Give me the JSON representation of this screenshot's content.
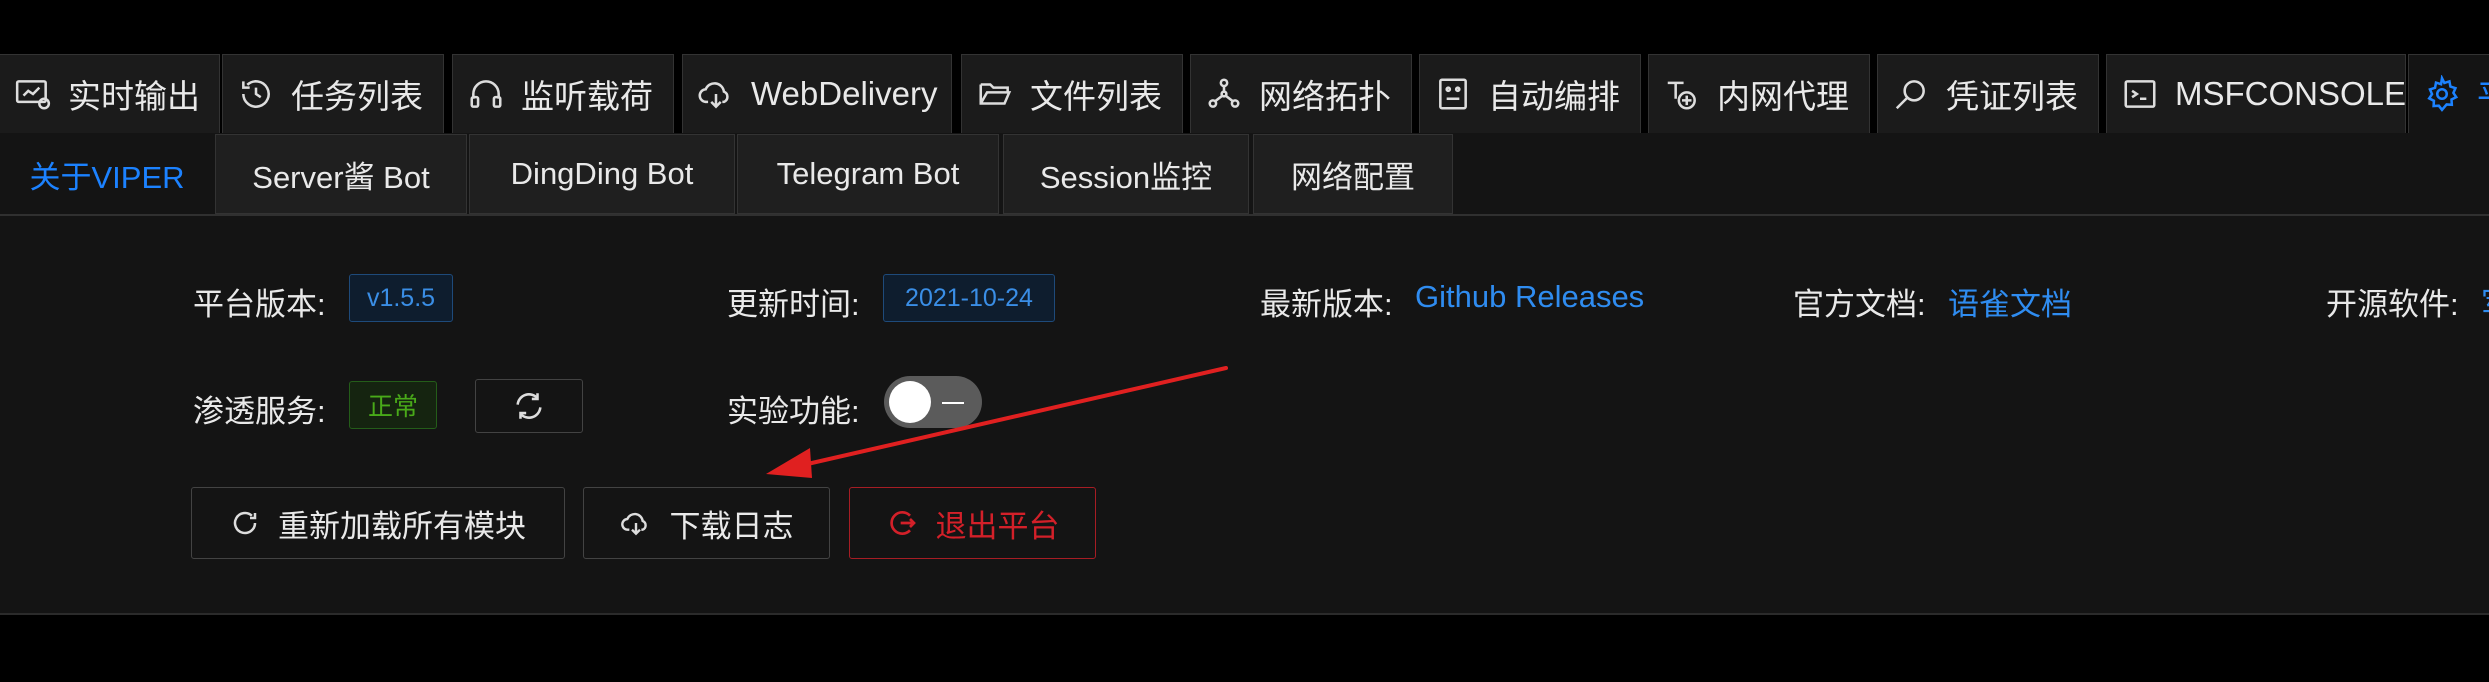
{
  "top_tabs": [
    {
      "label": "实时输出",
      "icon": "monitor-icon"
    },
    {
      "label": "任务列表",
      "icon": "history-icon"
    },
    {
      "label": "监听载荷",
      "icon": "headphones-icon"
    },
    {
      "label": "WebDelivery",
      "icon": "cloud-download-icon"
    },
    {
      "label": "文件列表",
      "icon": "folder-open-icon"
    },
    {
      "label": "网络拓扑",
      "icon": "topology-icon"
    },
    {
      "label": "自动编排",
      "icon": "robot-icon"
    },
    {
      "label": "内网代理",
      "icon": "proxy-icon"
    },
    {
      "label": "凭证列表",
      "icon": "key-search-icon"
    },
    {
      "label": "MSFCONSOLE",
      "icon": "code-icon"
    },
    {
      "label": "平",
      "icon": "gear-icon",
      "active": true
    }
  ],
  "sub_tabs": [
    {
      "label": "关于VIPER",
      "active": true
    },
    {
      "label": "Server酱 Bot"
    },
    {
      "label": "DingDing Bot"
    },
    {
      "label": "Telegram Bot"
    },
    {
      "label": "Session监控"
    },
    {
      "label": "网络配置"
    }
  ],
  "info": {
    "platform_version_label": "平台版本:",
    "platform_version": "v1.5.5",
    "update_time_label": "更新时间:",
    "update_time": "2021-10-24",
    "latest_version_label": "最新版本:",
    "latest_version_link": "Github Releases",
    "docs_label": "官方文档:",
    "docs_link": "语雀文档",
    "oss_label": "开源软件:",
    "oss_link": "军",
    "service_label": "渗透服务:",
    "service_status": "正常",
    "experimental_label": "实验功能:"
  },
  "actions": {
    "reload_label": "重新加载所有模块",
    "download_log_label": "下载日志",
    "logout_label": "退出平台"
  },
  "colors": {
    "accent": "#1c82ff",
    "link": "#2f8cf0",
    "danger": "#d32029",
    "success": "#49aa19",
    "annotation_arrow": "#e02020"
  }
}
